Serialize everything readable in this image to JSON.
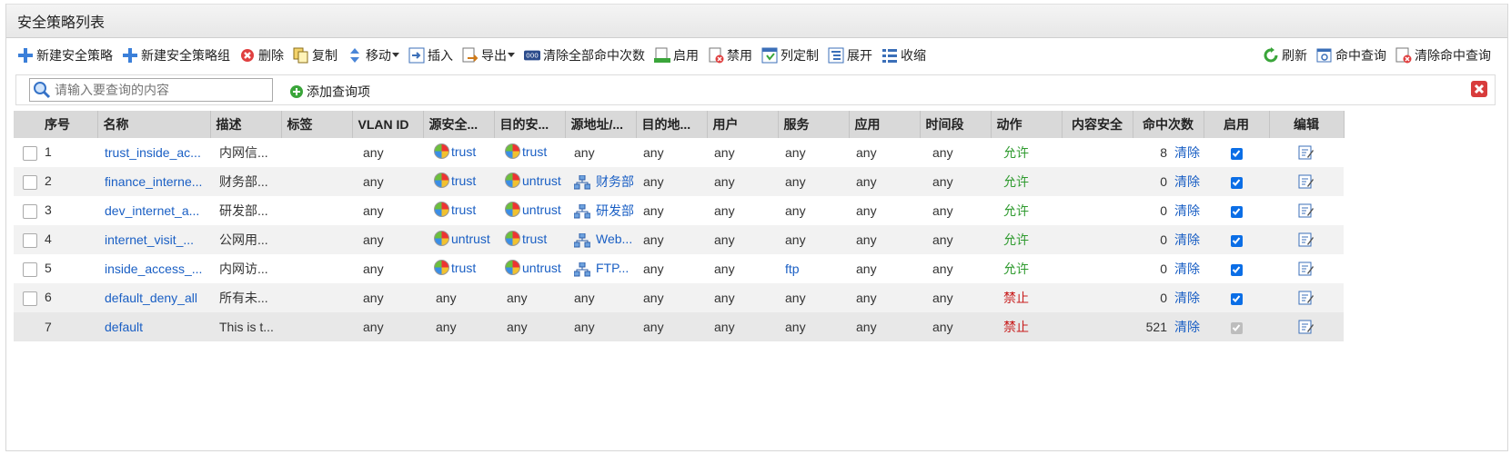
{
  "panel": {
    "title": "安全策略列表"
  },
  "toolbar": {
    "left": [
      {
        "label": "新建安全策略",
        "icon": "plus-icon"
      },
      {
        "label": "新建安全策略组",
        "icon": "plus-icon"
      },
      {
        "label": "删除",
        "icon": "delete-icon"
      },
      {
        "label": "复制",
        "icon": "copy-icon"
      },
      {
        "label": "移动",
        "icon": "move-icon"
      },
      {
        "label": "插入",
        "icon": "insert-icon"
      },
      {
        "label": "导出",
        "icon": "export-icon"
      },
      {
        "label": "清除全部命中次数",
        "icon": "clear-hits-icon"
      },
      {
        "label": "启用",
        "icon": "enable-icon"
      },
      {
        "label": "禁用",
        "icon": "disable-icon"
      },
      {
        "label": "列定制",
        "icon": "column-custom-icon"
      },
      {
        "label": "展开",
        "icon": "expand-icon"
      },
      {
        "label": "收缩",
        "icon": "collapse-icon"
      }
    ],
    "right": [
      {
        "label": "刷新",
        "icon": "refresh-icon"
      },
      {
        "label": "命中查询",
        "icon": "hit-query-icon"
      },
      {
        "label": "清除命中查询",
        "icon": "clear-query-icon"
      }
    ]
  },
  "search": {
    "placeholder": "请输入要查询的内容",
    "add_label": "添加查询项"
  },
  "table": {
    "columns": [
      "序号",
      "名称",
      "描述",
      "标签",
      "VLAN ID",
      "源安全...",
      "目的安...",
      "源地址/...",
      "目的地...",
      "用户",
      "服务",
      "应用",
      "时间段",
      "动作",
      "内容安全",
      "命中次数",
      "启用",
      "编辑"
    ],
    "clear_label": "清除",
    "rows": [
      {
        "no": "1",
        "name": "trust_inside_ac...",
        "desc": "内网信...",
        "tag": "",
        "vlan": "any",
        "src_zone": "trust",
        "dst_zone": "trust",
        "src_addr": "any",
        "dst_addr": "any",
        "user": "any",
        "service": "any",
        "app": "any",
        "time": "any",
        "action": "允许",
        "content": "",
        "hits": "8",
        "enabled": true
      },
      {
        "no": "2",
        "name": "finance_interne...",
        "desc": "财务部...",
        "tag": "",
        "vlan": "any",
        "src_zone": "trust",
        "dst_zone": "untrust",
        "src_addr": "财务部",
        "dst_addr": "any",
        "user": "any",
        "service": "any",
        "app": "any",
        "time": "any",
        "action": "允许",
        "content": "",
        "hits": "0",
        "enabled": true
      },
      {
        "no": "3",
        "name": "dev_internet_a...",
        "desc": "研发部...",
        "tag": "",
        "vlan": "any",
        "src_zone": "trust",
        "dst_zone": "untrust",
        "src_addr": "研发部",
        "dst_addr": "any",
        "user": "any",
        "service": "any",
        "app": "any",
        "time": "any",
        "action": "允许",
        "content": "",
        "hits": "0",
        "enabled": true
      },
      {
        "no": "4",
        "name": "internet_visit_...",
        "desc": "公网用...",
        "tag": "",
        "vlan": "any",
        "src_zone": "untrust",
        "dst_zone": "trust",
        "src_addr": "Web...",
        "dst_addr": "any",
        "user": "any",
        "service": "any",
        "app": "any",
        "time": "any",
        "action": "允许",
        "content": "",
        "hits": "0",
        "enabled": true
      },
      {
        "no": "5",
        "name": "inside_access_...",
        "desc": "内网访...",
        "tag": "",
        "vlan": "any",
        "src_zone": "trust",
        "dst_zone": "untrust",
        "src_addr": "FTP...",
        "dst_addr": "any",
        "user": "any",
        "service": "ftp",
        "app": "any",
        "time": "any",
        "action": "允许",
        "content": "",
        "hits": "0",
        "enabled": true
      },
      {
        "no": "6",
        "name": "default_deny_all",
        "desc": "所有未...",
        "tag": "",
        "vlan": "any",
        "src_zone": "any",
        "dst_zone": "any",
        "src_addr": "any",
        "dst_addr": "any",
        "user": "any",
        "service": "any",
        "app": "any",
        "time": "any",
        "action": "禁止",
        "content": "",
        "hits": "0",
        "enabled": true
      },
      {
        "no": "7",
        "name": "default",
        "desc": "This is t...",
        "tag": "",
        "vlan": "any",
        "src_zone": "any",
        "dst_zone": "any",
        "src_addr": "any",
        "dst_addr": "any",
        "user": "any",
        "service": "any",
        "app": "any",
        "time": "any",
        "action": "禁止",
        "content": "",
        "hits": "521",
        "enabled": true
      }
    ]
  },
  "colors": {
    "link": "#1a5fc4",
    "allow": "#2e9a2e",
    "deny": "#c81d1d",
    "checkbox": "#0b6ee6"
  }
}
